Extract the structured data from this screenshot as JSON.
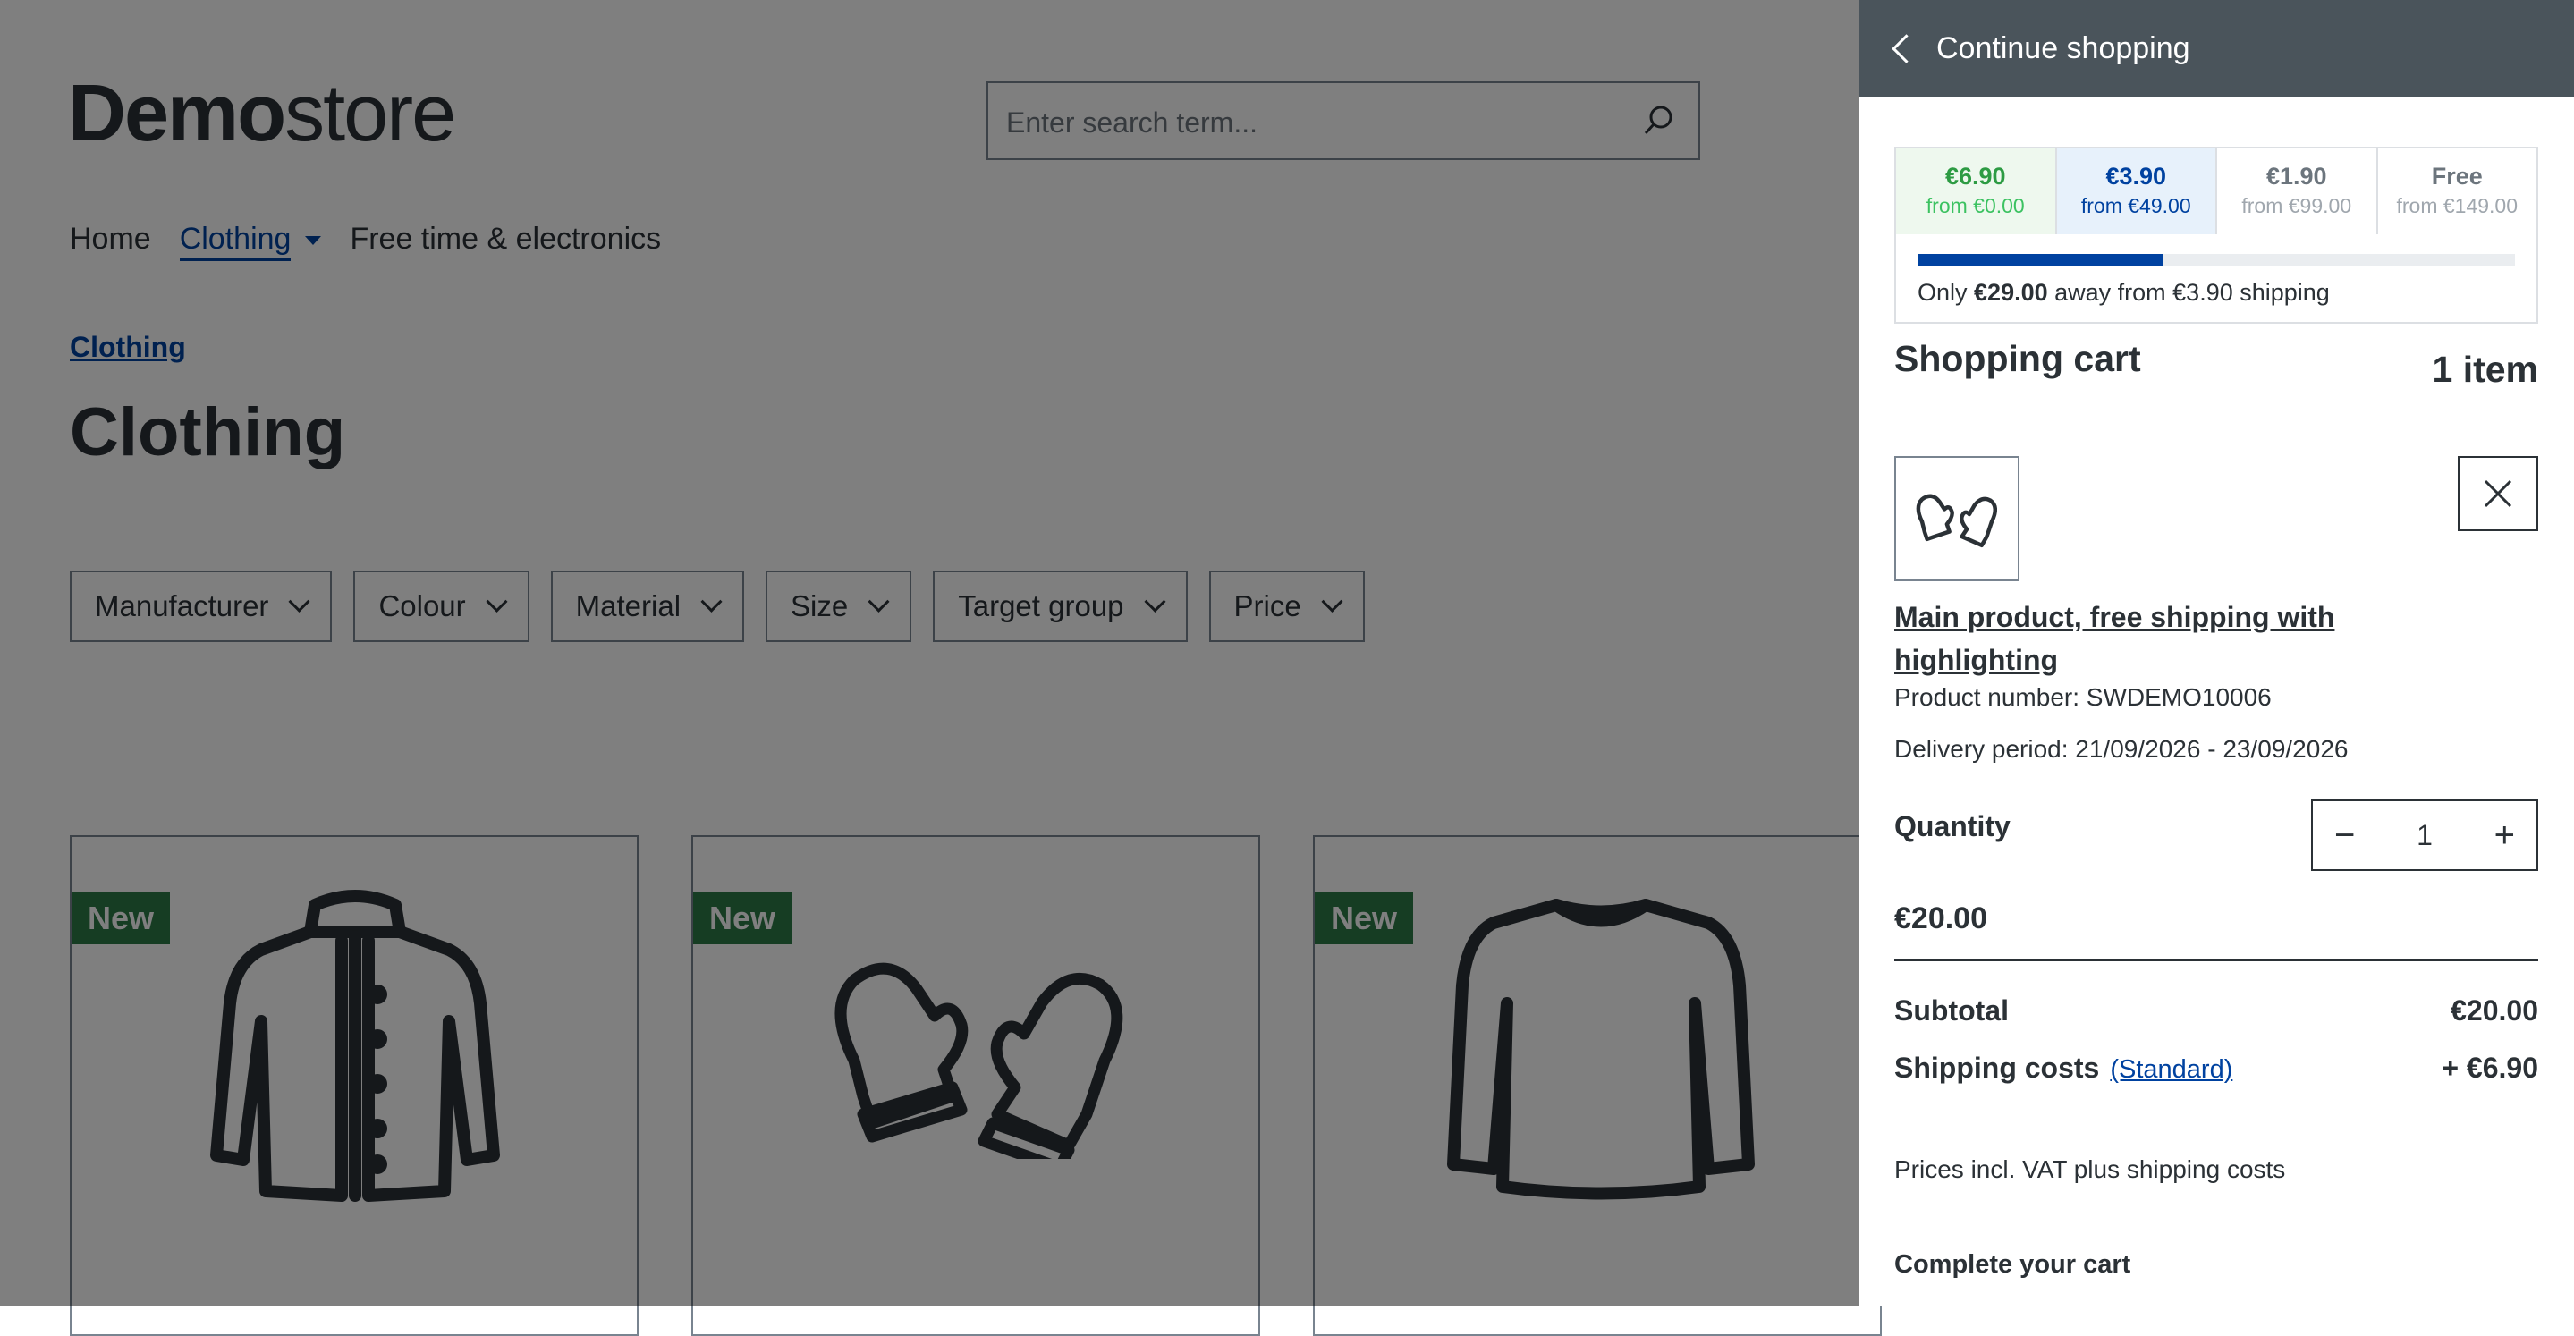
{
  "store": {
    "logo_bold": "Demo",
    "logo_light": "store",
    "search_placeholder": "Enter search term...",
    "nav": [
      {
        "label": "Home"
      },
      {
        "label": "Clothing"
      },
      {
        "label": "Free time & electronics"
      }
    ],
    "breadcrumb": "Clothing",
    "page_title": "Clothing",
    "filters": [
      "Manufacturer",
      "Colour",
      "Material",
      "Size",
      "Target group",
      "Price"
    ],
    "product_badges": [
      "New",
      "New",
      "New"
    ]
  },
  "cart": {
    "back_label": "Continue shopping",
    "shipping_tiers": [
      {
        "price": "€6.90",
        "from": "from €0.00"
      },
      {
        "price": "€3.90",
        "from": "from €49.00"
      },
      {
        "price": "€1.90",
        "from": "from €99.00"
      },
      {
        "price": "Free",
        "from": "from €149.00"
      }
    ],
    "progress_fraction": 0.41,
    "shipping_msg_prefix": "Only ",
    "shipping_msg_amount": "€29.00",
    "shipping_msg_suffix": " away from €3.90 shipping",
    "title": "Shopping cart",
    "item_count": "1 item",
    "product_name": "Main product, free shipping with highlighting",
    "product_number": "Product number: SWDEMO10006",
    "delivery_period": "Delivery period: 21/09/2026 - 23/09/2026",
    "quantity_label": "Quantity",
    "quantity_value": "1",
    "line_price": "€20.00",
    "subtotal_label": "Subtotal",
    "subtotal_value": "€20.00",
    "shipping_label": "Shipping costs",
    "shipping_method": "(Standard)",
    "shipping_value": "+ €6.90",
    "vat_note": "Prices incl. VAT plus shipping costs",
    "complete_label": "Complete your cart",
    "colors": {
      "accent": "#0042a0",
      "header": "#4a545b",
      "badge": "#2d7a47",
      "tier_green": "#2d9b43"
    }
  }
}
